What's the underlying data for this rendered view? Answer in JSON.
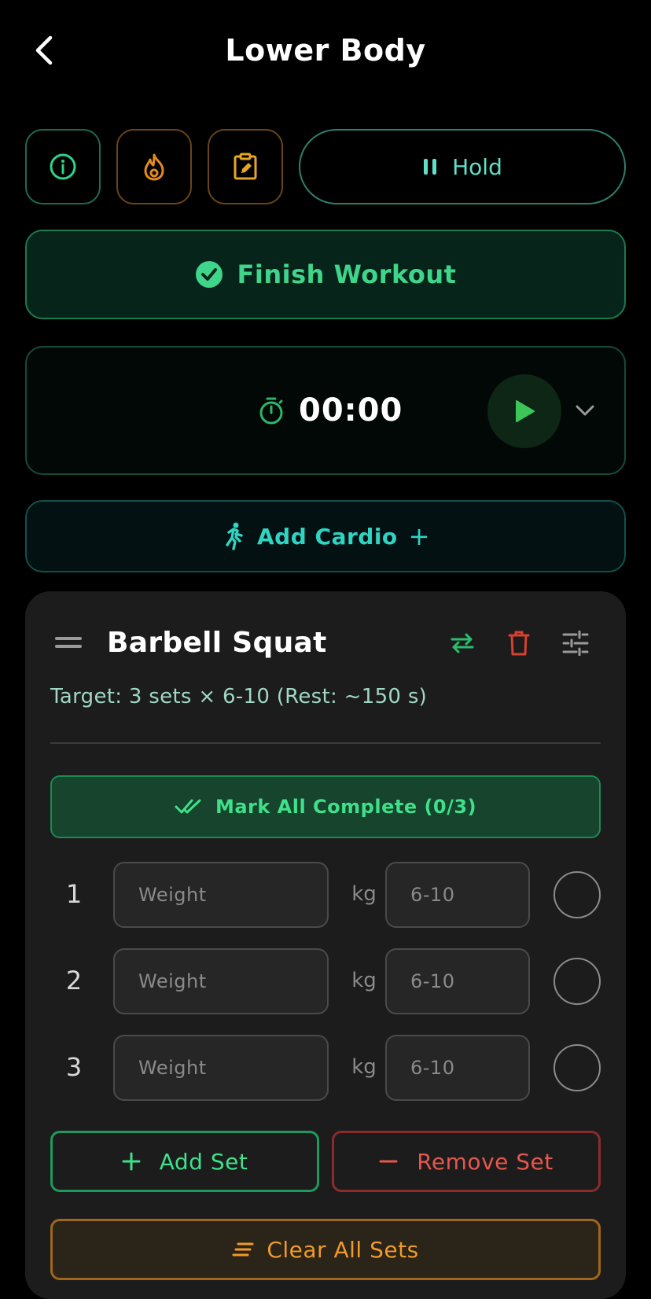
{
  "header": {
    "title": "Lower Body"
  },
  "toolbar": {
    "hold_label": "Hold",
    "icons": [
      "info-icon",
      "flame-icon",
      "clipboard-edit-icon",
      "pause-icon"
    ]
  },
  "finish": {
    "label": "Finish Workout"
  },
  "timer": {
    "value": "00:00"
  },
  "cardio": {
    "label": "Add Cardio",
    "plus": "+"
  },
  "exercise": {
    "name": "Barbell Squat",
    "target": "Target: 3 sets × 6-10 (Rest: ~150 s)",
    "mark_all": "Mark All Complete (0/3)",
    "unit": "kg",
    "sets": [
      {
        "num": "1",
        "weight_placeholder": "Weight",
        "reps_placeholder": "6-10"
      },
      {
        "num": "2",
        "weight_placeholder": "Weight",
        "reps_placeholder": "6-10"
      },
      {
        "num": "3",
        "weight_placeholder": "Weight",
        "reps_placeholder": "6-10"
      }
    ],
    "add_set": "Add Set",
    "remove_set": "Remove Set",
    "clear_all": "Clear All Sets"
  },
  "colors": {
    "green": "#3fd58a",
    "teal": "#2fd4c3",
    "orange": "#f19a2b",
    "red": "#e5574d"
  }
}
